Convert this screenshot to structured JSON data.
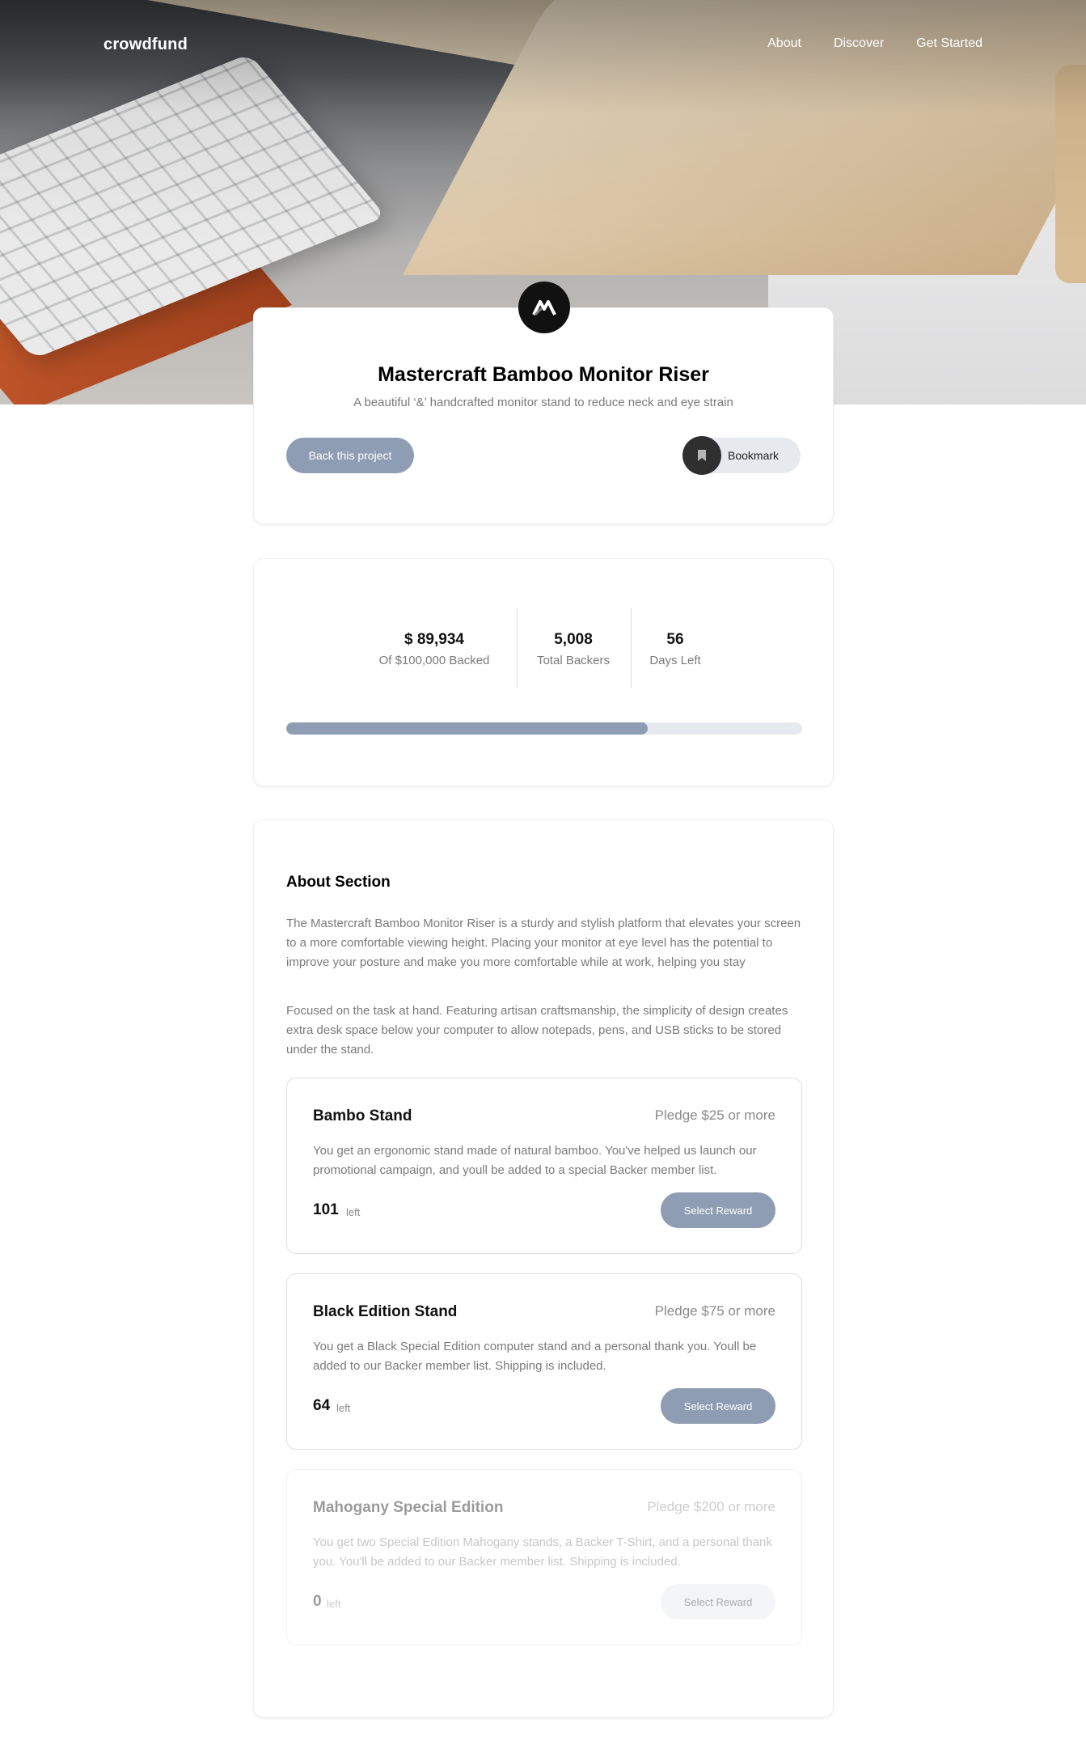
{
  "nav": {
    "logo": "crowdfund",
    "links": [
      "About",
      "Discover",
      "Get Started"
    ]
  },
  "project": {
    "badge_icon": "m-logo-icon",
    "title": "Mastercraft Bamboo Monitor Riser",
    "subtitle": "A beautiful ‘&’ handcrafted monitor stand to reduce neck and eye strain",
    "back_label": "Back this project",
    "bookmark_label": "Bookmark"
  },
  "stats": {
    "backed_amount": "$ 89,934",
    "backed_label": "Of $100,000 Backed",
    "backers": "5,008",
    "backers_label": "Total Backers",
    "days": "56",
    "days_label": "Days Left",
    "progress": 0.7
  },
  "about": {
    "title": "About Section",
    "paragraph_1": "The Mastercraft Bamboo Monitor Riser is a sturdy and stylish platform that elevates your screen to a more comfortable viewing height. Placing your monitor at eye level has the potential to improve your posture and make you more comfortable while at work, helping you stay",
    "paragraph_2": "Focused on the task at hand. Featuring artisan craftsmanship, the simplicity of design creates extra desk space below your computer to allow notepads, pens, and USB sticks to be stored under the stand."
  },
  "rewards": [
    {
      "name": "Bambo Stand",
      "pledge": "Pledge $25 or more",
      "description": "You get an ergonomic stand made of natural bamboo. You've helped us launch our promotional campaign, and youll be added to a special Backer member list.",
      "count": "101",
      "left_label": "left",
      "button": "Select Reward"
    },
    {
      "name": "Black Edition Stand",
      "pledge": "Pledge $75 or more",
      "description": "You get a Black Special Edition computer stand and a personal thank you. Youll be added to our Backer member list. Shipping is included.",
      "count": "64",
      "left_label": "left",
      "button": "Select Reward"
    },
    {
      "name": "Mahogany Special Edition",
      "pledge": "Pledge $200 or more",
      "description": "You get two Special Edition Mahogany stands, a Backer T-Shirt, and a personal thank you. You'll be added to our Backer member list. Shipping is included.",
      "count": "0",
      "left_label": "left",
      "button": "Select Reward"
    }
  ],
  "colors": {
    "accent": "#8e9db3",
    "track": "#e6e9ee",
    "text_muted": "#7a7a7a"
  }
}
